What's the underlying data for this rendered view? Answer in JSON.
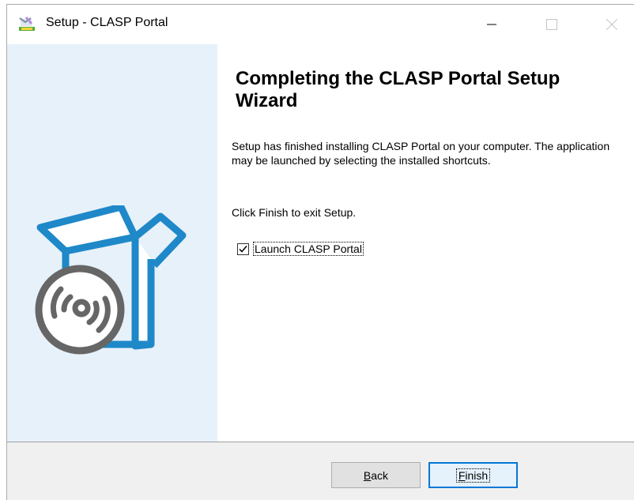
{
  "window": {
    "title": "Setup - CLASP Portal",
    "app_icon": "setup-installer-icon",
    "controls": {
      "minimize": "minimize-icon",
      "maximize": "maximize-icon",
      "close": "close-icon"
    }
  },
  "wizard": {
    "heading": "Completing the CLASP Portal Setup Wizard",
    "message_1": "Setup has finished installing CLASP Portal on your computer. The application may be launched by selecting the installed shortcuts.",
    "message_2": "Click Finish to exit Setup.",
    "launch_checkbox": {
      "label": "Launch CLASP Portal",
      "checked": true
    }
  },
  "footer": {
    "back_label_prefix": "",
    "back_label_mnemonic": "B",
    "back_label_rest": "ack",
    "finish_label_mnemonic": "F",
    "finish_label_rest": "inish"
  },
  "colors": {
    "side_panel": "#e7f1fa",
    "illustration": "#1e88c9",
    "disc": "#666666",
    "primary_button_border": "#0078d7"
  }
}
